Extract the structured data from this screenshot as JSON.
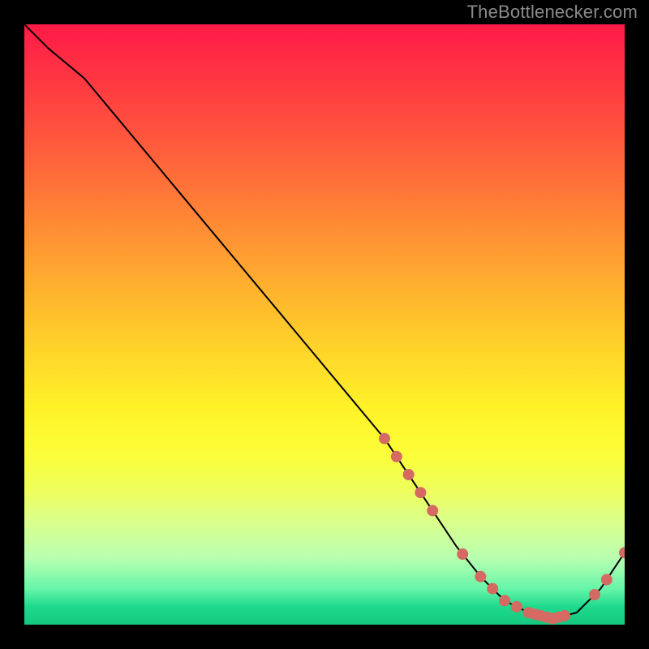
{
  "attribution": "TheBottlenecker.com",
  "chart_data": {
    "type": "line",
    "title": "",
    "xlabel": "",
    "ylabel": "",
    "xlim": [
      0,
      100
    ],
    "ylim": [
      0,
      100
    ],
    "x": [
      0,
      4,
      10,
      20,
      30,
      40,
      50,
      60,
      64,
      68,
      72,
      76,
      80,
      84,
      88,
      92,
      96,
      100
    ],
    "values": [
      100,
      96,
      91,
      79,
      67,
      55,
      43,
      31,
      25,
      19,
      13,
      8,
      4,
      2,
      1,
      2,
      6,
      12
    ],
    "marker_points_x": [
      60,
      62,
      64,
      66,
      68,
      73,
      76,
      78,
      80,
      82,
      84,
      85,
      86,
      87,
      88,
      89,
      90,
      95,
      97,
      100
    ],
    "marker_color": "#d46a62",
    "line_color": "#000000",
    "line_width": 2,
    "background_gradient": {
      "stops": [
        "#ff1a47",
        "#ffb82d",
        "#fff227",
        "#1fd98d"
      ],
      "positions_pct": [
        0,
        46,
        64,
        97
      ]
    }
  },
  "colors": {
    "page_bg": "#000000",
    "attribution_text": "#8b8b8b"
  }
}
